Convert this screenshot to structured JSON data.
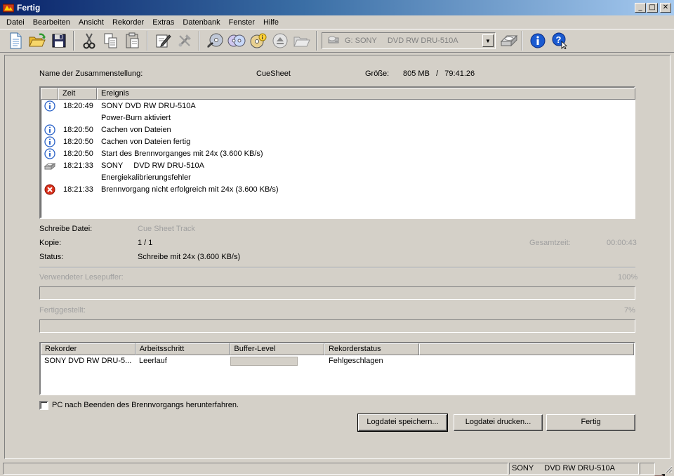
{
  "window": {
    "title": "Fertig"
  },
  "menu": [
    "Datei",
    "Bearbeiten",
    "Ansicht",
    "Rekorder",
    "Extras",
    "Datenbank",
    "Fenster",
    "Hilfe"
  ],
  "toolbar": {
    "drive_select_value": "G: SONY     DVD RW DRU-510A"
  },
  "info": {
    "compilation_label": "Name der Zusammenstellung:",
    "compilation_value": "CueSheet",
    "size_label": "Größe:",
    "size_value": "805 MB   /   79:41.26"
  },
  "log": {
    "columns": [
      "",
      "Zeit",
      "Ereignis"
    ],
    "rows": [
      {
        "icon": "info-icon",
        "time": "18:20:49",
        "event": "SONY DVD RW DRU-510A"
      },
      {
        "icon": "",
        "time": "",
        "event": "Power-Burn aktiviert"
      },
      {
        "icon": "info-icon",
        "time": "18:20:50",
        "event": "Cachen von Dateien"
      },
      {
        "icon": "info-icon",
        "time": "18:20:50",
        "event": "Cachen von Dateien fertig"
      },
      {
        "icon": "info-icon",
        "time": "18:20:50",
        "event": "Start des Brennvorganges mit 24x (3.600 KB/s)"
      },
      {
        "icon": "drive-icon",
        "time": "18:21:33",
        "event": "SONY     DVD RW DRU-510A"
      },
      {
        "icon": "",
        "time": "",
        "event": "Energiekalibrierungsfehler"
      },
      {
        "icon": "error-icon",
        "time": "18:21:33",
        "event": "Brennvorgang nicht erfolgreich mit 24x (3.600 KB/s)"
      }
    ]
  },
  "status": {
    "write_file_label": "Schreibe Datei:",
    "write_file_value": "Cue Sheet Track",
    "copy_label": "Kopie:",
    "copy_value": "1 / 1",
    "total_time_label": "Gesamtzeit:",
    "total_time_value": "00:00:43",
    "status_label": "Status:",
    "status_value": "Schreibe mit 24x (3.600 KB/s)",
    "buffer_label": "Verwendeter Lesepuffer:",
    "buffer_percent": "100%",
    "buffer_fraction": 0,
    "done_label": "Fertiggestellt:",
    "done_percent": "7%",
    "done_fraction": 0
  },
  "recorders": {
    "columns": [
      "Rekorder",
      "Arbeitsschritt",
      "Buffer-Level",
      "Rekorderstatus",
      ""
    ],
    "rows": [
      {
        "recorder": "SONY DVD RW DRU-5...",
        "step": "Leerlauf",
        "buffer_level": 0,
        "status": "Fehlgeschlagen"
      }
    ]
  },
  "shutdown_checkbox_label": "PC nach Beenden des Brennvorgangs herunterfahren.",
  "shutdown_checked": false,
  "buttons": {
    "save_log": "Logdatei speichern...",
    "print_log": "Logdatei drucken...",
    "done": "Fertig"
  },
  "statusbar": {
    "drive": "SONY     DVD RW DRU-510A"
  }
}
